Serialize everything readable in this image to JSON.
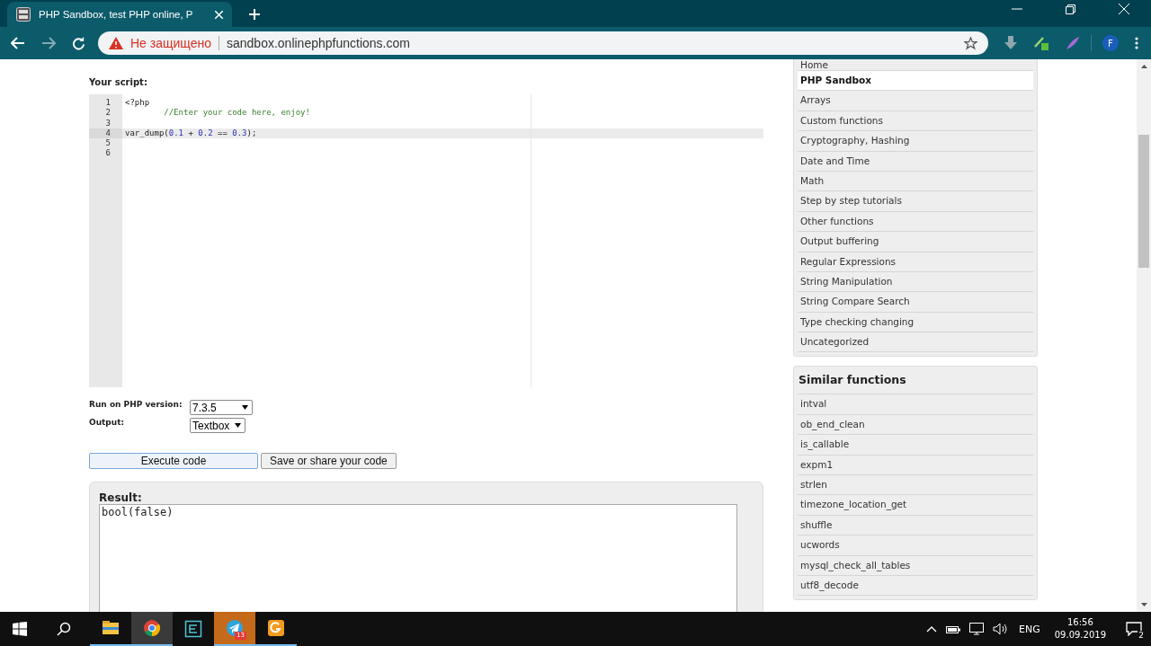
{
  "browser": {
    "tab": {
      "title": "PHP Sandbox, test PHP online, P",
      "selected": true
    },
    "security_label": "Не защищено",
    "url": "sandbox.onlinephpfunctions.com",
    "profile_initial": "F"
  },
  "script": {
    "label": "Your script:",
    "lines": [
      {
        "number": "1",
        "highlighted": false,
        "tokens": [
          {
            "text": "<?php",
            "kind": "plain"
          }
        ]
      },
      {
        "number": "2",
        "highlighted": false,
        "tokens": [
          {
            "text": "        //Enter your code here, enjoy!",
            "kind": "comment"
          }
        ]
      },
      {
        "number": "3",
        "highlighted": false
      },
      {
        "number": "4",
        "highlighted": true,
        "tokens": [
          {
            "text": "var_dump(",
            "kind": "plain"
          },
          {
            "text": "0.1",
            "kind": "number"
          },
          {
            "text": " + ",
            "kind": "plain"
          },
          {
            "text": "0.2",
            "kind": "number"
          },
          {
            "text": " == ",
            "kind": "plain"
          },
          {
            "text": "0.3",
            "kind": "number"
          },
          {
            "text": ");",
            "kind": "plain"
          }
        ]
      },
      {
        "number": "5",
        "highlighted": false
      },
      {
        "number": "6",
        "highlighted": false
      }
    ]
  },
  "options": [
    {
      "label": "Run on PHP version:",
      "value": "7.3.5"
    },
    {
      "label": "Output:",
      "value": "Textbox"
    }
  ],
  "buttons": [
    {
      "label": "Execute code",
      "focused": true
    },
    {
      "label": "Save or share your code",
      "focused": false
    }
  ],
  "result": {
    "label": "Result:",
    "value": "bool(false)"
  },
  "sidebar": {
    "items": [
      {
        "label": "Home",
        "selected": false
      },
      {
        "label": "PHP Sandbox",
        "selected": true
      },
      {
        "label": "Arrays",
        "selected": false
      },
      {
        "label": "Custom functions",
        "selected": false
      },
      {
        "label": "Cryptography, Hashing",
        "selected": false
      },
      {
        "label": "Date and Time",
        "selected": false
      },
      {
        "label": "Math",
        "selected": false
      },
      {
        "label": "Step by step tutorials",
        "selected": false
      },
      {
        "label": "Other functions",
        "selected": false
      },
      {
        "label": "Output buffering",
        "selected": false
      },
      {
        "label": "Regular Expressions",
        "selected": false
      },
      {
        "label": "String Manipulation",
        "selected": false
      },
      {
        "label": "String Compare Search",
        "selected": false
      },
      {
        "label": "Type checking changing",
        "selected": false
      },
      {
        "label": "Uncategorized",
        "selected": false
      }
    ]
  },
  "similar": {
    "title": "Similar functions",
    "items": [
      "intval",
      "ob_end_clean",
      "is_callable",
      "expm1",
      "strlen",
      "timezone_location_get",
      "shuffle",
      "ucwords",
      "mysql_check_all_tables",
      "utf8_decode"
    ]
  },
  "taskbar": {
    "apps": [
      {
        "kind": "explorer"
      },
      {
        "kind": "chrome",
        "active": true
      },
      {
        "kind": "terminal"
      },
      {
        "kind": "telegram",
        "badge": "13"
      },
      {
        "kind": "pdf"
      }
    ],
    "language": "ENG",
    "time": "16:56",
    "date": "09.09.2019",
    "notifications": "2"
  }
}
